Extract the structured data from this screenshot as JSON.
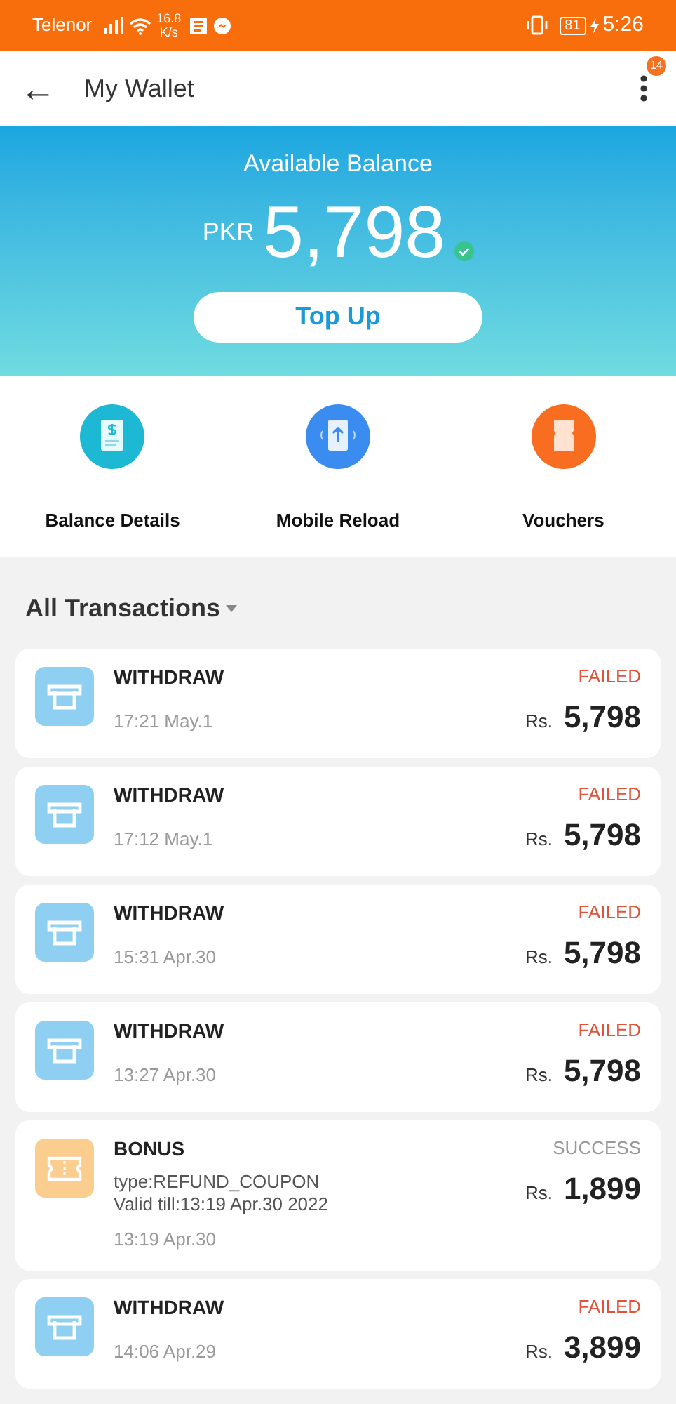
{
  "status_bar": {
    "carrier": "Telenor",
    "speed_value": "16.8",
    "speed_unit": "K/s",
    "battery": "81",
    "time": "5:26"
  },
  "header": {
    "back": "←",
    "title": "My Wallet",
    "badge": "14"
  },
  "balance": {
    "label": "Available Balance",
    "currency": "PKR",
    "amount": "5,798",
    "verified": true,
    "button": "Top Up"
  },
  "shortcuts": [
    {
      "kind": "balance",
      "label": "Balance Details"
    },
    {
      "kind": "reload",
      "label": "Mobile Reload"
    },
    {
      "kind": "voucher",
      "label": "Vouchers"
    }
  ],
  "transactions_header": {
    "title": "All Transactions"
  },
  "transactions": [
    {
      "kind": "withdraw",
      "title": "WITHDRAW",
      "time": "17:21 May.1",
      "status": "FAILED",
      "failed": true,
      "currency": "Rs.",
      "amount": "5,798"
    },
    {
      "kind": "withdraw",
      "title": "WITHDRAW",
      "time": "17:12 May.1",
      "status": "FAILED",
      "failed": true,
      "currency": "Rs.",
      "amount": "5,798"
    },
    {
      "kind": "withdraw",
      "title": "WITHDRAW",
      "time": "15:31 Apr.30",
      "status": "FAILED",
      "failed": true,
      "currency": "Rs.",
      "amount": "5,798"
    },
    {
      "kind": "withdraw",
      "title": "WITHDRAW",
      "time": "13:27 Apr.30",
      "status": "FAILED",
      "failed": true,
      "currency": "Rs.",
      "amount": "5,798"
    },
    {
      "kind": "bonus",
      "title": "BONUS",
      "details": [
        "type:REFUND_COUPON",
        "Valid till:13:19 Apr.30 2022"
      ],
      "time": "13:19 Apr.30",
      "status": "SUCCESS",
      "failed": false,
      "currency": "Rs.",
      "amount": "1,899"
    },
    {
      "kind": "withdraw",
      "title": "WITHDRAW",
      "time": "14:06 Apr.29",
      "status": "FAILED",
      "failed": true,
      "currency": "Rs.",
      "amount": "3,899"
    }
  ]
}
